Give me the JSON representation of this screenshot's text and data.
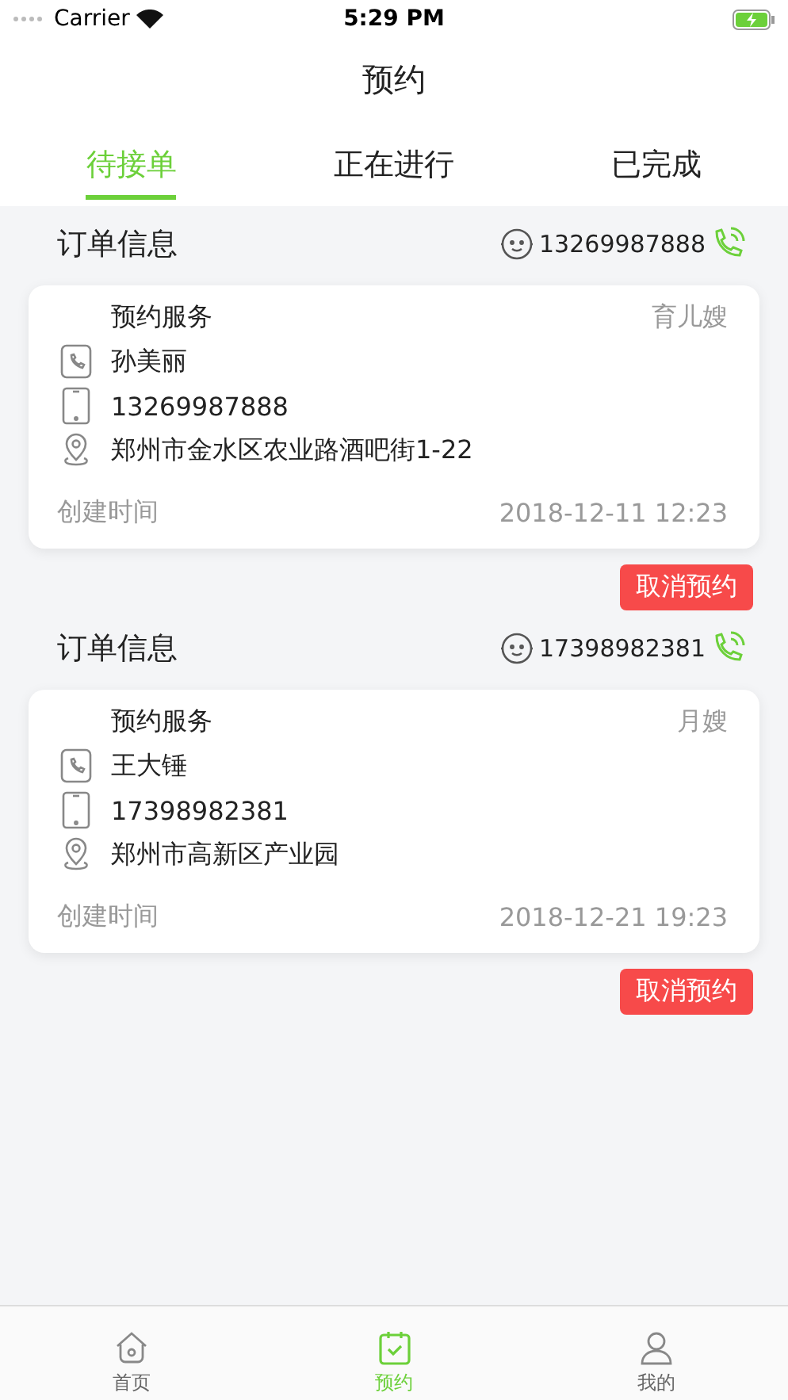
{
  "status_bar": {
    "carrier": "Carrier",
    "time": "5:29 PM"
  },
  "title": "预约",
  "tabs": [
    {
      "label": "待接单",
      "selected": true
    },
    {
      "label": "正在进行",
      "selected": false
    },
    {
      "label": "已完成",
      "selected": false
    }
  ],
  "orders": [
    {
      "header": "订单信息",
      "service_phone": "13269987888",
      "service_label": "预约服务",
      "service_type": "育儿嫂",
      "name": "孙美丽",
      "phone": "13269987888",
      "address": "郑州市金水区农业路酒吧街1-22",
      "created_label": "创建时间",
      "created_time": "2018-12-11 12:23",
      "action": "取消预约"
    },
    {
      "header": "订单信息",
      "service_phone": "17398982381",
      "service_label": "预约服务",
      "service_type": "月嫂",
      "name": "王大锤",
      "phone": "17398982381",
      "address": "郑州市高新区产业园",
      "created_label": "创建时间",
      "created_time": "2018-12-21 19:23",
      "action": "取消预约"
    }
  ],
  "tab_bar": [
    {
      "label": "首页",
      "kind": "home",
      "selected": false
    },
    {
      "label": "预约",
      "kind": "calendar",
      "selected": true
    },
    {
      "label": "我的",
      "kind": "user",
      "selected": false
    }
  ]
}
